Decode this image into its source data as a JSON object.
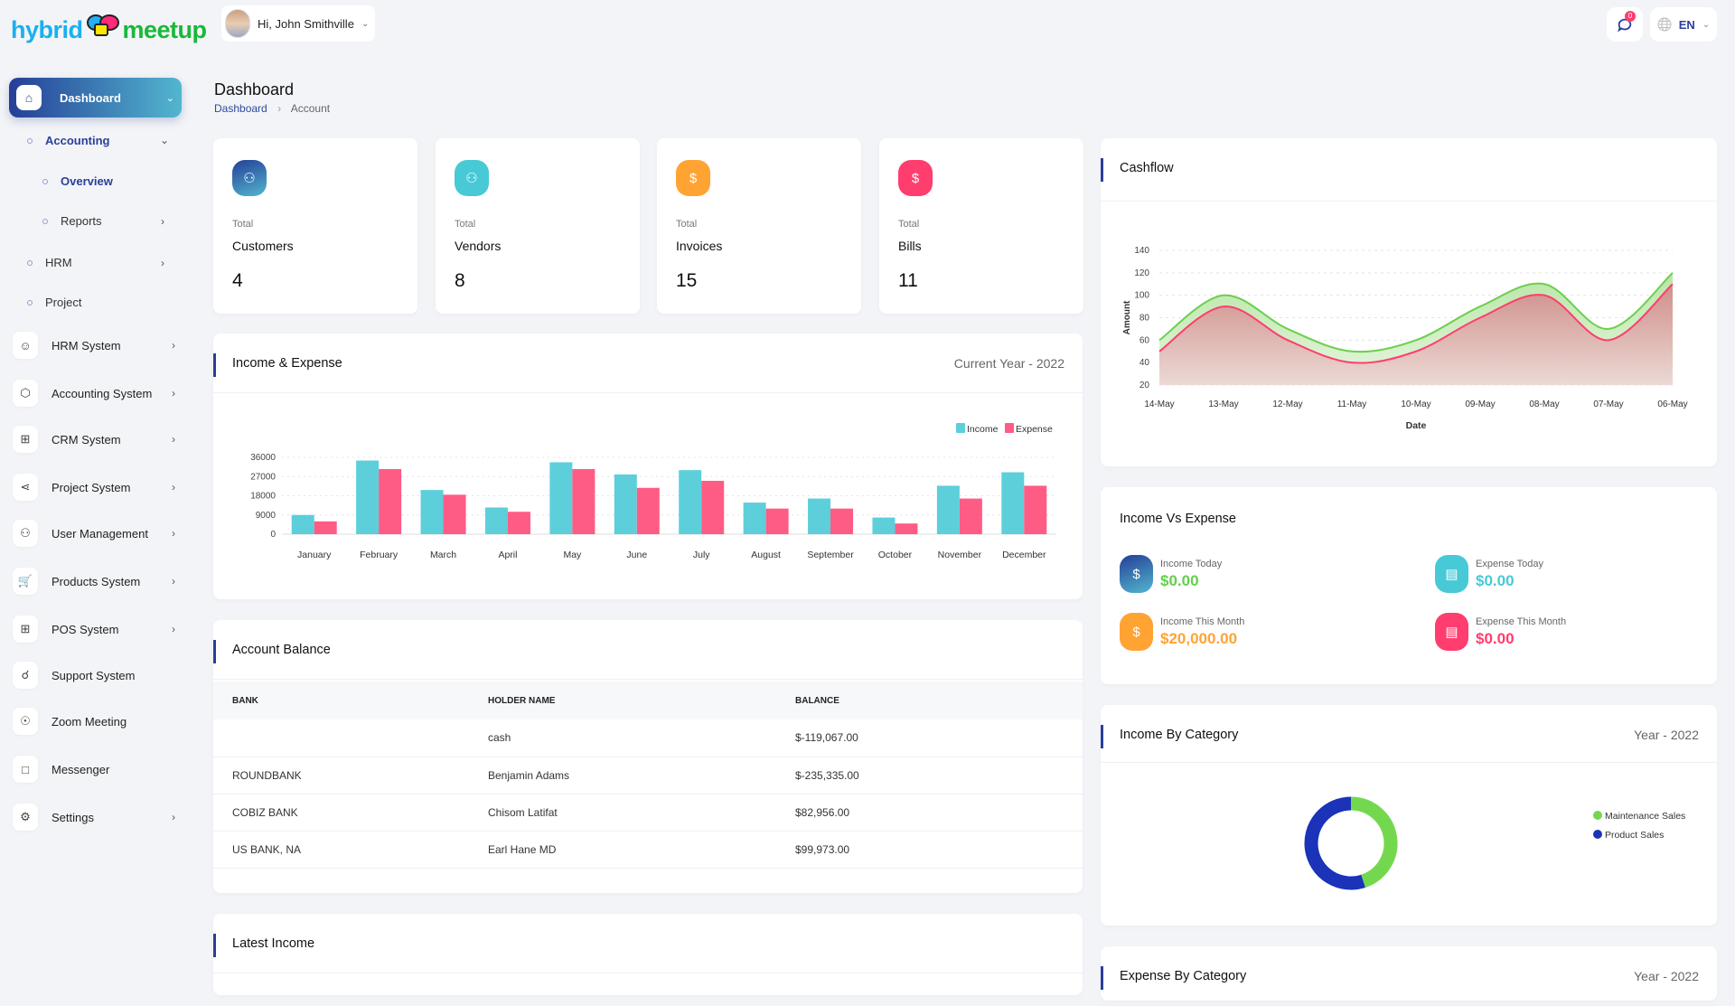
{
  "app": {
    "logo_text_1": "hybrid",
    "logo_text_2": "meetup"
  },
  "header": {
    "greeting": "Hi, John Smithville",
    "notifications_count": "0",
    "language": "EN"
  },
  "sidebar": {
    "dashboard": "Dashboard",
    "sub_items": [
      {
        "label": "Accounting",
        "active": true
      },
      {
        "label": "Overview",
        "active": true
      },
      {
        "label": "Reports"
      },
      {
        "label": "HRM"
      },
      {
        "label": "Project"
      }
    ],
    "items": [
      {
        "label": "HRM System",
        "icon": "user-icon",
        "has_children": true
      },
      {
        "label": "Accounting System",
        "icon": "box-icon",
        "has_children": true
      },
      {
        "label": "CRM System",
        "icon": "layers-plus-icon",
        "has_children": true
      },
      {
        "label": "Project System",
        "icon": "share-icon",
        "has_children": true
      },
      {
        "label": "User Management",
        "icon": "users-icon",
        "has_children": true
      },
      {
        "label": "Products System",
        "icon": "cart-icon",
        "has_children": true
      },
      {
        "label": "POS System",
        "icon": "layers-plus-icon",
        "has_children": true
      },
      {
        "label": "Support System",
        "icon": "headset-icon",
        "has_children": false
      },
      {
        "label": "Zoom Meeting",
        "icon": "user-video-icon",
        "has_children": false
      },
      {
        "label": "Messenger",
        "icon": "chat-icon",
        "has_children": false
      },
      {
        "label": "Settings",
        "icon": "gear-icon",
        "has_children": true
      }
    ]
  },
  "page": {
    "title": "Dashboard",
    "breadcrumb": [
      "Dashboard",
      "Account"
    ]
  },
  "stats": [
    {
      "pre": "Total",
      "label": "Customers",
      "value": "4",
      "color": "#2d4aa0",
      "icon": "users-icon"
    },
    {
      "pre": "Total",
      "label": "Vendors",
      "value": "8",
      "color": "#48c9d6",
      "icon": "users-icon"
    },
    {
      "pre": "Total",
      "label": "Invoices",
      "value": "15",
      "color": "#ffa333",
      "icon": "clipboard-dollar-icon"
    },
    {
      "pre": "Total",
      "label": "Bills",
      "value": "11",
      "color": "#ff3d6e",
      "icon": "clipboard-dollar-icon"
    }
  ],
  "income_expense": {
    "title": "Income & Expense",
    "period": "Current Year - 2022"
  },
  "account_balance": {
    "title": "Account Balance",
    "columns": [
      "BANK",
      "HOLDER NAME",
      "BALANCE"
    ],
    "rows": [
      [
        "",
        "cash",
        "$-119,067.00"
      ],
      [
        "ROUNDBANK",
        "Benjamin Adams",
        "$-235,335.00"
      ],
      [
        "COBIZ BANK",
        "Chisom Latifat",
        "$82,956.00"
      ],
      [
        "US BANK, NA",
        "Earl Hane MD",
        "$99,973.00"
      ]
    ]
  },
  "latest_income": {
    "title": "Latest Income"
  },
  "cashflow": {
    "title": "Cashflow"
  },
  "income_vs_expense": {
    "title": "Income Vs Expense",
    "items": [
      {
        "label": "Income Today",
        "value": "$0.00",
        "color": "#62d04a",
        "icon_color": "#2d4aa0"
      },
      {
        "label": "Expense Today",
        "value": "$0.00",
        "color": "#48c9d6",
        "icon_color": "#48c9d6"
      },
      {
        "label": "Income This Month",
        "value": "$20,000.00",
        "color": "#ffa333",
        "icon_color": "#ffa333"
      },
      {
        "label": "Expense This Month",
        "value": "$0.00",
        "color": "#ff3d6e",
        "icon_color": "#ff3d6e"
      }
    ]
  },
  "income_by_category": {
    "title": "Income By Category",
    "period": "Year - 2022"
  },
  "expense_by_category": {
    "title": "Expense By Category",
    "period": "Year - 2022"
  },
  "chart_data": [
    {
      "type": "bar",
      "categories": [
        "January",
        "February",
        "March",
        "April",
        "May",
        "June",
        "July",
        "August",
        "September",
        "October",
        "November",
        "December"
      ],
      "series": [
        {
          "name": "Income",
          "color": "#5ccfdb",
          "values": [
            9000,
            34500,
            20700,
            12500,
            33700,
            28000,
            30000,
            14800,
            16700,
            7800,
            22700,
            29000
          ]
        },
        {
          "name": "Expense",
          "color": "#ff5c85",
          "values": [
            6000,
            30500,
            18500,
            10500,
            30500,
            21700,
            25000,
            12000,
            12000,
            5000,
            16700,
            22700
          ]
        }
      ],
      "ylim": [
        0,
        36000
      ],
      "yticks": [
        0,
        9000,
        18000,
        27000,
        36000
      ],
      "grid": true,
      "legend": "top-right"
    },
    {
      "type": "area",
      "x": [
        "14-May",
        "13-May",
        "12-May",
        "11-May",
        "10-May",
        "09-May",
        "08-May",
        "07-May",
        "06-May"
      ],
      "series": [
        {
          "color": "#6ccf4e",
          "values": [
            60,
            100,
            70,
            50,
            60,
            90,
            110,
            70,
            120
          ]
        },
        {
          "color": "#ff3d6e",
          "values": [
            50,
            90,
            60,
            40,
            50,
            80,
            100,
            60,
            110
          ]
        }
      ],
      "xlabel": "Date",
      "ylabel": "Amount",
      "ylim": [
        20,
        140
      ],
      "yticks": [
        20,
        40,
        60,
        80,
        100,
        120,
        140
      ],
      "grid": true
    },
    {
      "type": "pie",
      "donut": true,
      "labels": [
        "Maintenance Sales",
        "Product Sales"
      ],
      "values": [
        45,
        55
      ],
      "colors": [
        "#74d84f",
        "#1a33b8"
      ],
      "legend": "right"
    }
  ]
}
